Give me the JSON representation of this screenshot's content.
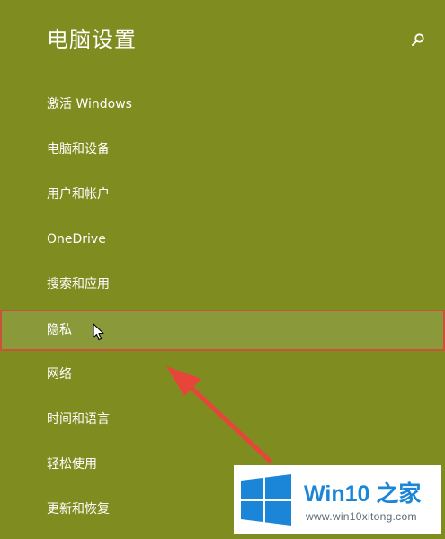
{
  "window": {
    "title": "电脑设置"
  },
  "header": {
    "search_icon": "search-icon"
  },
  "menu": {
    "items": [
      {
        "label": "激活 Windows"
      },
      {
        "label": "电脑和设备"
      },
      {
        "label": "用户和帐户"
      },
      {
        "label": "OneDrive"
      },
      {
        "label": "搜索和应用"
      },
      {
        "label": "隐私",
        "selected": true
      },
      {
        "label": "网络"
      },
      {
        "label": "时间和语言"
      },
      {
        "label": "轻松使用"
      },
      {
        "label": "更新和恢复"
      }
    ]
  },
  "colors": {
    "background": "#7f8c1f",
    "selected_background": "#8a9a3a",
    "selected_border": "#c8533a",
    "annotation_arrow": "#e8453a",
    "watermark_blue": "#1b86d8"
  },
  "watermark": {
    "brand": "Win10 之家",
    "url": "www.win10xitong.com"
  }
}
